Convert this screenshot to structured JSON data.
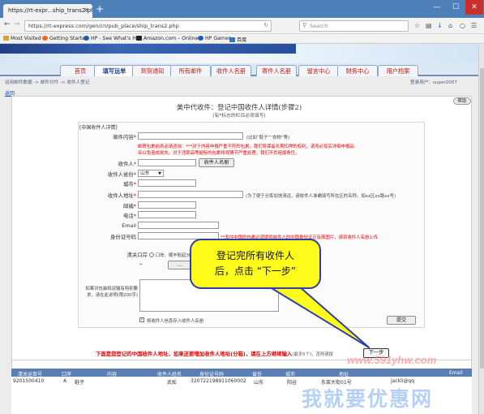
{
  "browser": {
    "tab_title": "https://rt-expr...ship_trans2.php",
    "tab_close": "✕",
    "new_tab": "+",
    "url": "https://rt-express.com/gen/cn/pub_place/ship_trans2.php",
    "search_placeholder": "Search",
    "window_controls": [
      "—",
      "☐",
      "✕"
    ],
    "bookmarks": [
      "Most Visited",
      "Getting Started",
      "HP - See What's Hot",
      "Amazon.com – Online...",
      "HP Games",
      "百度"
    ]
  },
  "menu": {
    "items": [
      "首页",
      "填写运单",
      "到货通知",
      "所有邮件",
      "收件人名册",
      "寄件人名册",
      "留言中心",
      "财务中心",
      "用户档案"
    ],
    "active_index": 1
  },
  "crumb": {
    "path": "运用邮件数据 -> 邮件付件 -> 收件人登记",
    "user": "登录用户：super2007"
  },
  "back_link": "返回",
  "help_button": "帮助",
  "form": {
    "title": "美中代收件：登记中国收件人详情(步骤2)",
    "subtitle": "(有*标志的栏目必须填写)",
    "legend": "[中国收件人详情]",
    "fields": {
      "content_label": "邮件内容",
      "content_hint": "(比如“鞋子”“衣物”等)",
      "warning_line1": "邮寄包裹前务必请咨询：***对于内容申报严重不符的包裹，我们将保留长期扣押的权利，请务必如实详细申报品",
      "warning_line2": "名以免造成损失。对于违禁品等超标的包裹将视情节严重处理，我们不负赔偿责任。",
      "name_label": "收件人",
      "name_button": "收件人名册",
      "province_label": "收件人省份",
      "province_value": "山东",
      "city_label": "城市",
      "address_label": "收件人地址",
      "address_hint": "(为了便于分拣加快清运，请收件人准确填写所在区的名称，如xx区xx路xx号)",
      "zip_label": "邮编",
      "phone_label": "电话",
      "email_label": "Email",
      "id_label": "身份证号码",
      "id_warning": "**发往中国的包裹必须提供收件人的中国身份证正反面图片，请到收件人名册上传",
      "customs_label": "清关口岸",
      "customs_value": "口岸、顺丰航起38+&",
      "extra_label": "如果对包装和运输有特别要求，请在此说明(限200字)",
      "save_checkbox_label": "将收件人信息存入收件人名册",
      "submit_button": "提交"
    }
  },
  "bottom": {
    "message": "下面是您登记的中国收件人地址，如果还要增加收件人地址(分箱)，请在上方继续输入",
    "message_small": "(最多5个)，否则请按",
    "next_button": "下一步"
  },
  "table": {
    "headers": [
      "清关运单号",
      "口岸",
      "内容",
      "收件人姓名",
      "身份证号码",
      "省份",
      "城市",
      "地址",
      "Email"
    ],
    "rows": [
      [
        "9201500410",
        "A",
        "鞋子",
        "武松",
        "320722198911060002",
        "山东",
        "阳谷",
        "东菜大街01号",
        "jackli@qq"
      ]
    ]
  },
  "callout": {
    "line1": "登记完所有收件人",
    "line2": "后，点击 “下一步”"
  },
  "watermark": {
    "line1": "www.591yhw.com",
    "line2": "我就要优惠网"
  },
  "colors": {
    "tabbar": "#4f7fb8",
    "menu_text": "#c0180f",
    "warning": "#ee0000",
    "callout_bg": "#fffb1a",
    "callout_border": "#2f3fa8",
    "table_header": "#5a7fb2"
  }
}
